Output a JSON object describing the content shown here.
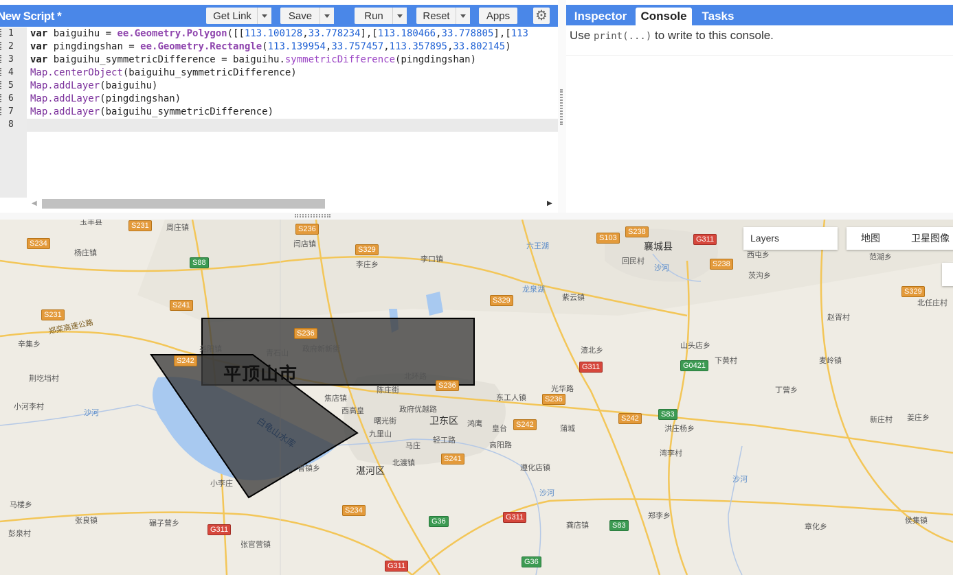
{
  "editor": {
    "title": "New Script *",
    "buttons": {
      "get_link": "Get Link",
      "save": "Save",
      "run": "Run",
      "reset": "Reset",
      "apps": "Apps"
    },
    "line_numbers": [
      "1",
      "2",
      "3",
      "4",
      "5",
      "6",
      "7",
      "8"
    ],
    "code": [
      {
        "kw": "var",
        "a": " baiguihu = ",
        "ee": "ee.Geometry.Polygon",
        "b": "([[",
        "n1": "113.100128",
        "c": ",",
        "n2": "33.778234",
        "d": "],[",
        "n3": "113.180466",
        "e": ",",
        "n4": "33.778805",
        "f": "],[",
        "n5": "113"
      },
      {
        "kw": "var",
        "a": " pingdingshan = ",
        "ee": "ee.Geometry.Rectangle",
        "b": "(",
        "n1": "113.139954",
        "c": ",",
        "n2": "33.757457",
        "d": ",",
        "n3": "113.357895",
        "e": ",",
        "n4": "33.802145",
        "f": ")"
      },
      {
        "kw": "var",
        "a": " baiguihu_symmetricDifference = baiguihu.",
        "mt": "symmetricDifference",
        "b": "(pingdingshan)"
      },
      {
        "mp": "Map.centerObject",
        "b": "(baiguihu_symmetricDifference)"
      },
      {
        "mp": "Map.addLayer",
        "b": "(baiguihu)"
      },
      {
        "mp": "Map.addLayer",
        "b": "(pingdingshan)"
      },
      {
        "mp": "Map.addLayer",
        "b": "(baiguihu_symmetricDifference)"
      }
    ]
  },
  "right_panel": {
    "tabs": [
      "Inspector",
      "Console",
      "Tasks"
    ],
    "active_tab": "Console",
    "console": {
      "before": "Use ",
      "code": "print(...)",
      "after": " to write to this console."
    }
  },
  "map": {
    "layers_label": "Layers",
    "map_types": [
      "地图",
      "卫星图像"
    ],
    "city_label": "平顶山市",
    "district_labels": [
      "卫东区",
      "湛河区",
      "襄城县"
    ],
    "place_labels": [
      "周庄镇",
      "闫店镇",
      "李庄乡",
      "李口镇",
      "杨庄镇",
      "回民村",
      "西屯乡",
      "范湖乡",
      "茨沟乡",
      "紫云镇",
      "北任庄村",
      "赵胥村",
      "渣北乡",
      "山头店乡",
      "下黄村",
      "麦岭镇",
      "辛集乡",
      "荆圪垱村",
      "尧阳镇",
      "青石山",
      "政府新新街",
      "北环路",
      "焦店镇",
      "陈庄街",
      "光华路",
      "东工人镇",
      "丁营乡",
      "西高皇",
      "政府优越路",
      "曙光街",
      "九里山",
      "鸿鹰",
      "皇台",
      "蒲城",
      "洪庄杨乡",
      "新庄村",
      "姜庄乡",
      "小河李村",
      "马庄",
      "轻工路",
      "高阳路",
      "湾李村",
      "北渡镇",
      "遵化店镇",
      "曹镇乡",
      "小李庄",
      "马楼乡",
      "张良镇",
      "碾子营乡",
      "彭泉村",
      "张官营镇",
      "龚店镇",
      "郑李乡",
      "章化乡",
      "侯集镇",
      "玉丰县"
    ],
    "water_labels": [
      "六王湖",
      "龙泉湖",
      "沙河",
      "沙河",
      "沙河",
      "沙河",
      "白龟山水库"
    ],
    "road_shields": [
      {
        "t": "S231",
        "c": "o"
      },
      {
        "t": "S236",
        "c": "o"
      },
      {
        "t": "S234",
        "c": "o"
      },
      {
        "t": "S329",
        "c": "o"
      },
      {
        "t": "S88",
        "c": "g"
      },
      {
        "t": "S103",
        "c": "o"
      },
      {
        "t": "S238",
        "c": "o"
      },
      {
        "t": "G311",
        "c": "r"
      },
      {
        "t": "S238",
        "c": "o"
      },
      {
        "t": "S241",
        "c": "o"
      },
      {
        "t": "S329",
        "c": "o"
      },
      {
        "t": "S231",
        "c": "o"
      },
      {
        "t": "S329",
        "c": "o"
      },
      {
        "t": "S236",
        "c": "o"
      },
      {
        "t": "S242",
        "c": "o"
      },
      {
        "t": "G311",
        "c": "r"
      },
      {
        "t": "G0421",
        "c": "g"
      },
      {
        "t": "S236",
        "c": "o"
      },
      {
        "t": "S236",
        "c": "o"
      },
      {
        "t": "S242",
        "c": "o"
      },
      {
        "t": "S242",
        "c": "o"
      },
      {
        "t": "S83",
        "c": "g"
      },
      {
        "t": "S241",
        "c": "o"
      },
      {
        "t": "S234",
        "c": "o"
      },
      {
        "t": "G36",
        "c": "g"
      },
      {
        "t": "G311",
        "c": "r"
      },
      {
        "t": "G311",
        "c": "r"
      },
      {
        "t": "S83",
        "c": "g"
      },
      {
        "t": "G36",
        "c": "g"
      },
      {
        "t": "G311",
        "c": "r"
      }
    ],
    "expressway_label": "郑栾高速公路"
  },
  "colors": {
    "accent": "#4a87e8",
    "geometry_fill": "#3c3c3c",
    "geometry_stroke": "#000000"
  }
}
